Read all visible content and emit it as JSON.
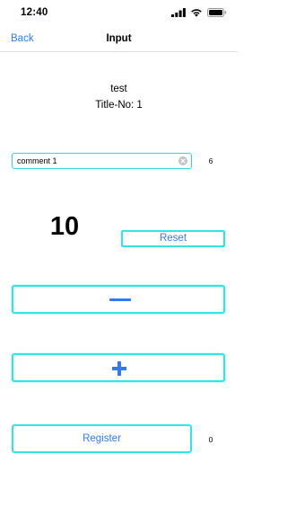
{
  "status_bar": {
    "time": "12:40",
    "icons": [
      "cellular-signal-icon",
      "wifi-icon",
      "battery-icon"
    ]
  },
  "nav": {
    "back_label": "Back",
    "title": "Input"
  },
  "item": {
    "name": "test",
    "title_no": "Title-No: 1"
  },
  "comment": {
    "value": "comment 1",
    "char_count": "6"
  },
  "counter": {
    "value": "10",
    "reset_label": "Reset",
    "minus_icon": "minus-icon",
    "plus_icon": "plus-icon"
  },
  "register": {
    "label": "Register",
    "count": "0"
  },
  "colors": {
    "accent": "#2f7bf5",
    "border": "#2ee6e6"
  }
}
